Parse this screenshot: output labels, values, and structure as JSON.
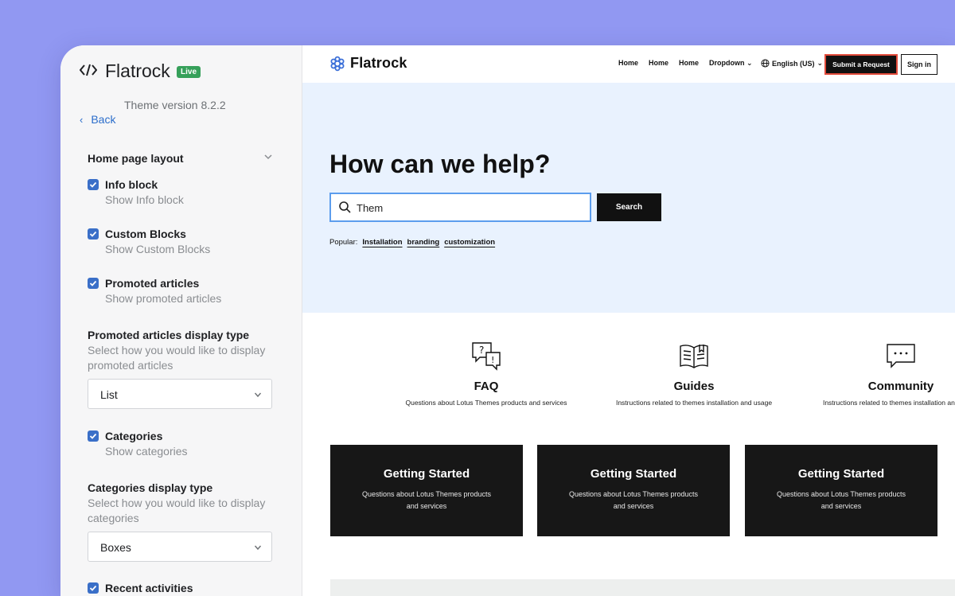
{
  "panel": {
    "app_name": "Flatrock",
    "badge": "Live",
    "version": "Theme version 8.2.2",
    "back": "Back",
    "section_title": "Home page layout",
    "options": {
      "info": {
        "label": "Info block",
        "help": "Show Info block",
        "checked": true
      },
      "custom": {
        "label": "Custom Blocks",
        "help": "Show Custom Blocks",
        "checked": true
      },
      "promoted": {
        "label": "Promoted articles",
        "help": "Show promoted articles",
        "checked": true
      },
      "categories": {
        "label": "Categories",
        "help": "Show categories",
        "checked": true
      },
      "recent": {
        "label": "Recent activities",
        "checked": true
      }
    },
    "promoted_type": {
      "label": "Promoted articles display type",
      "help": "Select how you would like to display promoted articles",
      "value": "List"
    },
    "categories_type": {
      "label": "Categories display type",
      "help": "Select how you would like to display categories",
      "value": "Boxes"
    }
  },
  "preview": {
    "nav": {
      "logo": "Flatrock",
      "links": [
        "Home",
        "Home",
        "Home",
        "Dropdown"
      ],
      "language": "English (US)",
      "submit": "Submit a Request",
      "signin": "Sign in"
    },
    "hero": {
      "title": "How can we help?",
      "search_value": "Them",
      "search_button": "Search",
      "popular_label": "Popular:",
      "popular_tags": [
        "Installation",
        "branding",
        "customization"
      ]
    },
    "features": [
      {
        "icon": "faq-chat-icon",
        "title": "FAQ",
        "desc": "Questions about Lotus Themes products and services"
      },
      {
        "icon": "guides-book-icon",
        "title": "Guides",
        "desc": "Instructions related to themes installation and usage"
      },
      {
        "icon": "community-chat-icon",
        "title": "Community",
        "desc": "Instructions related to themes installation and usage"
      }
    ],
    "cards": [
      {
        "title": "Getting Started",
        "desc": "Questions about Lotus Themes products and services"
      },
      {
        "title": "Getting Started",
        "desc": "Questions about Lotus Themes products and services"
      },
      {
        "title": "Getting Started",
        "desc": "Questions about Lotus Themes products and services"
      }
    ]
  },
  "colors": {
    "background": "#9198f2",
    "accent": "#3a6fc8",
    "badge_green": "#36a05a",
    "hero_bg": "#e9f2fe",
    "submit_outline": "#e24b3b"
  }
}
